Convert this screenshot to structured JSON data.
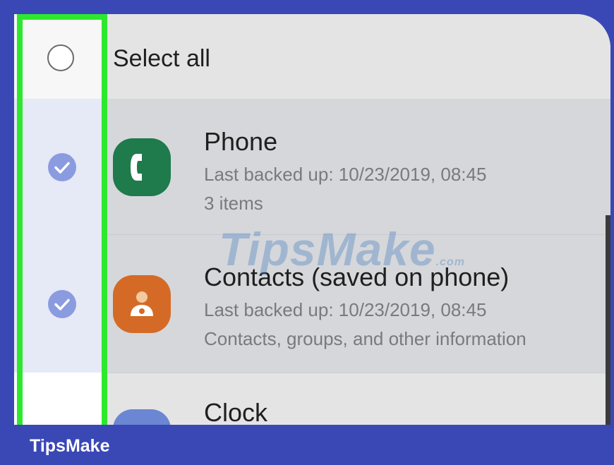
{
  "select_all": {
    "label": "Select all",
    "checked": false
  },
  "items": [
    {
      "title": "Phone",
      "line1": "Last backed up: 10/23/2019, 08:45",
      "line2": "3 items",
      "checked": true,
      "icon": "phone-icon",
      "icon_color": "#1f7a4c"
    },
    {
      "title": "Contacts (saved on phone)",
      "line1": "Last backed up: 10/23/2019, 08:45",
      "line2": "Contacts, groups, and other information",
      "checked": true,
      "icon": "contact-person-icon",
      "icon_color": "#d56a26"
    },
    {
      "title": "Clock",
      "icon": "clock-icon",
      "icon_color": "#6b86d2"
    }
  ],
  "watermark": {
    "main": "TipsMake",
    "suffix": ".com"
  },
  "footer": {
    "brand": "TipsMake"
  },
  "colors": {
    "highlight": "#2ee82e",
    "check": "#8b9be0",
    "frame": "#3a48b6"
  }
}
